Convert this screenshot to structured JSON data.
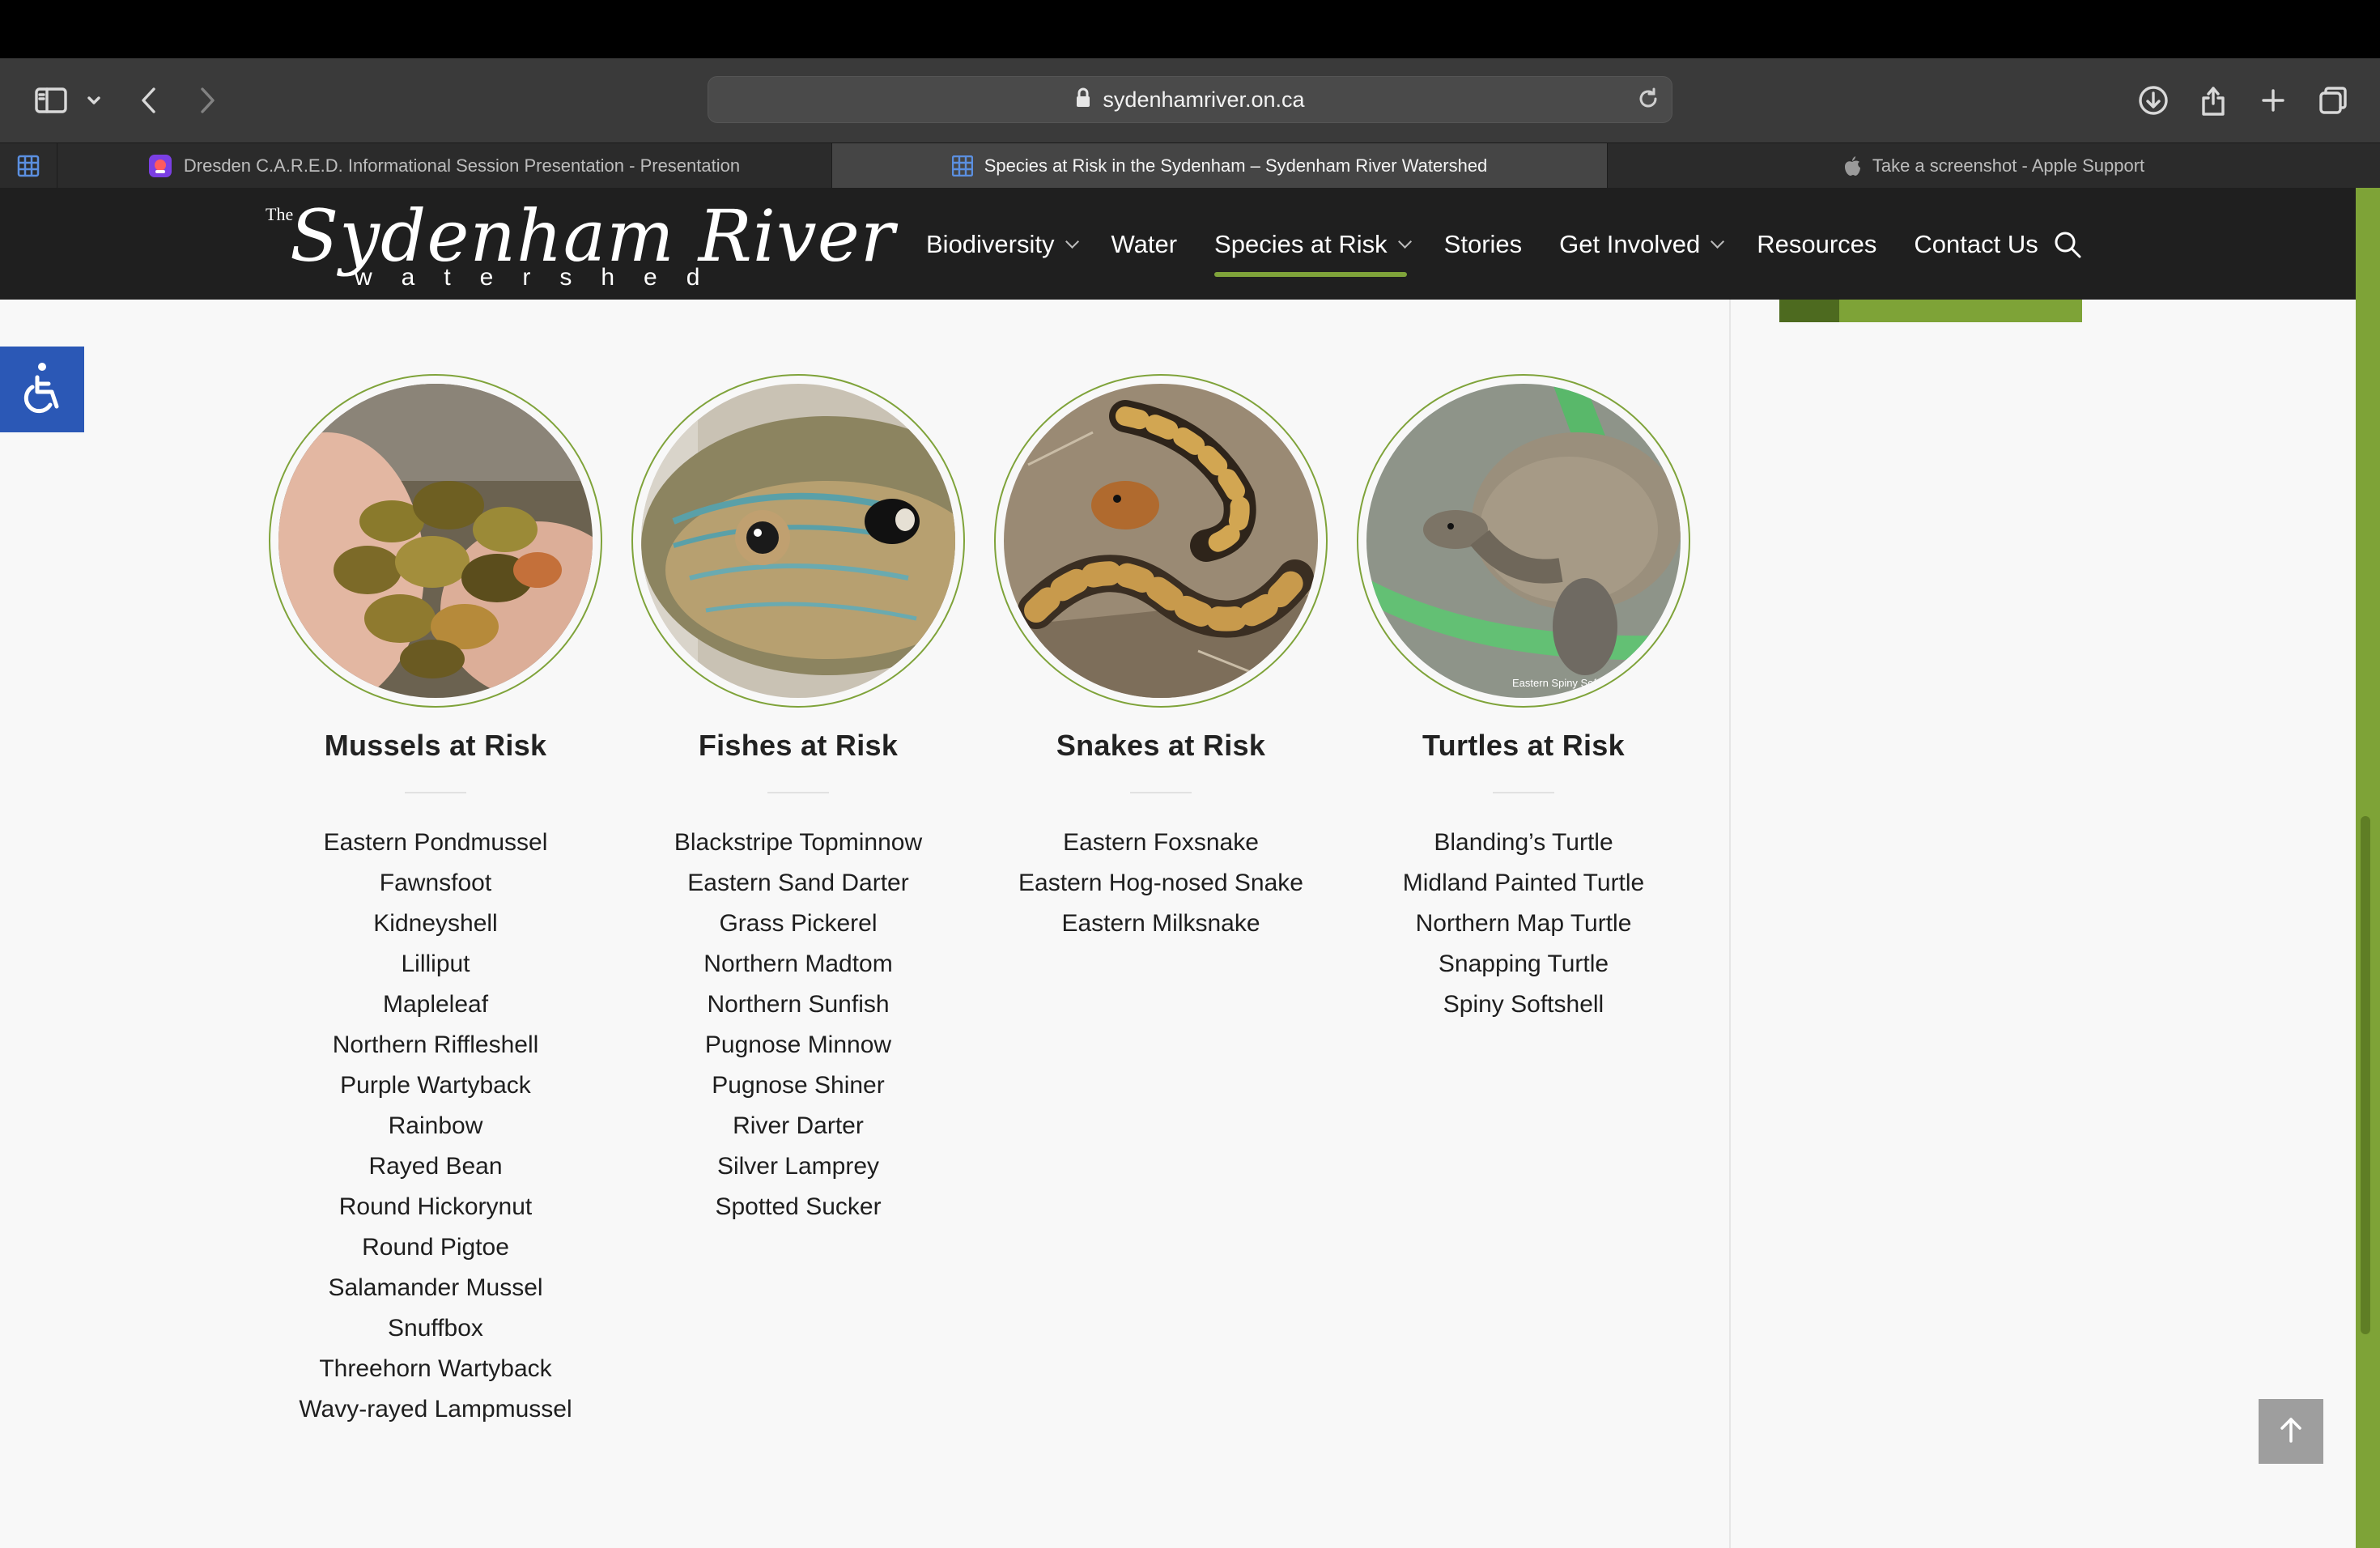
{
  "browser": {
    "url": "sydenhamriver.on.ca",
    "tabs": [
      {
        "label": "Dresden C.A.R.E.D. Informational Session Presentation - Presentation",
        "icon": "presentation-app-icon"
      },
      {
        "label": "Species at Risk in the Sydenham – Sydenham River Watershed",
        "icon": "site-grid-icon"
      },
      {
        "label": "Take a screenshot - Apple Support",
        "icon": "apple-icon"
      }
    ]
  },
  "site": {
    "logo": {
      "the": "The",
      "main": "Sydenham River",
      "sub": "watershed"
    },
    "nav": [
      {
        "label": "Biodiversity",
        "dropdown": true
      },
      {
        "label": "Water",
        "dropdown": false
      },
      {
        "label": "Species at Risk",
        "dropdown": true,
        "active": true
      },
      {
        "label": "Stories",
        "dropdown": false
      },
      {
        "label": "Get Involved",
        "dropdown": true
      },
      {
        "label": "Resources",
        "dropdown": false
      },
      {
        "label": "Contact Us",
        "dropdown": false
      }
    ],
    "accent_color": "#7fa33a"
  },
  "categories": [
    {
      "title": "Mussels at Risk",
      "image": "mussels-photo",
      "species": [
        "Eastern Pondmussel",
        "Fawnsfoot",
        "Kidneyshell",
        "Lilliput",
        "Mapleleaf",
        "Northern Riffleshell",
        "Purple Wartyback",
        "Rainbow",
        "Rayed Bean",
        "Round Hickorynut",
        "Round Pigtoe",
        "Salamander Mussel",
        "Snuffbox",
        "Threehorn Wartyback",
        "Wavy-rayed Lampmussel"
      ]
    },
    {
      "title": "Fishes at Risk",
      "image": "fish-photo",
      "species": [
        "Blackstripe Topminnow",
        "Eastern Sand Darter",
        "Grass Pickerel",
        "Northern Madtom",
        "Northern Sunfish",
        "Pugnose Minnow",
        "Pugnose Shiner",
        "River Darter",
        "Silver Lamprey",
        "Spotted Sucker"
      ]
    },
    {
      "title": "Snakes at Risk",
      "image": "snake-photo",
      "species": [
        "Eastern Foxsnake",
        "Eastern Hog-nosed Snake",
        "Eastern Milksnake"
      ]
    },
    {
      "title": "Turtles at Risk",
      "image": "turtle-photo",
      "image_caption": "Eastern Spiny Sof",
      "species": [
        "Blanding’s Turtle",
        "Midland Painted Turtle",
        "Northern Map Turtle",
        "Snapping Turtle",
        "Spiny Softshell"
      ]
    }
  ]
}
